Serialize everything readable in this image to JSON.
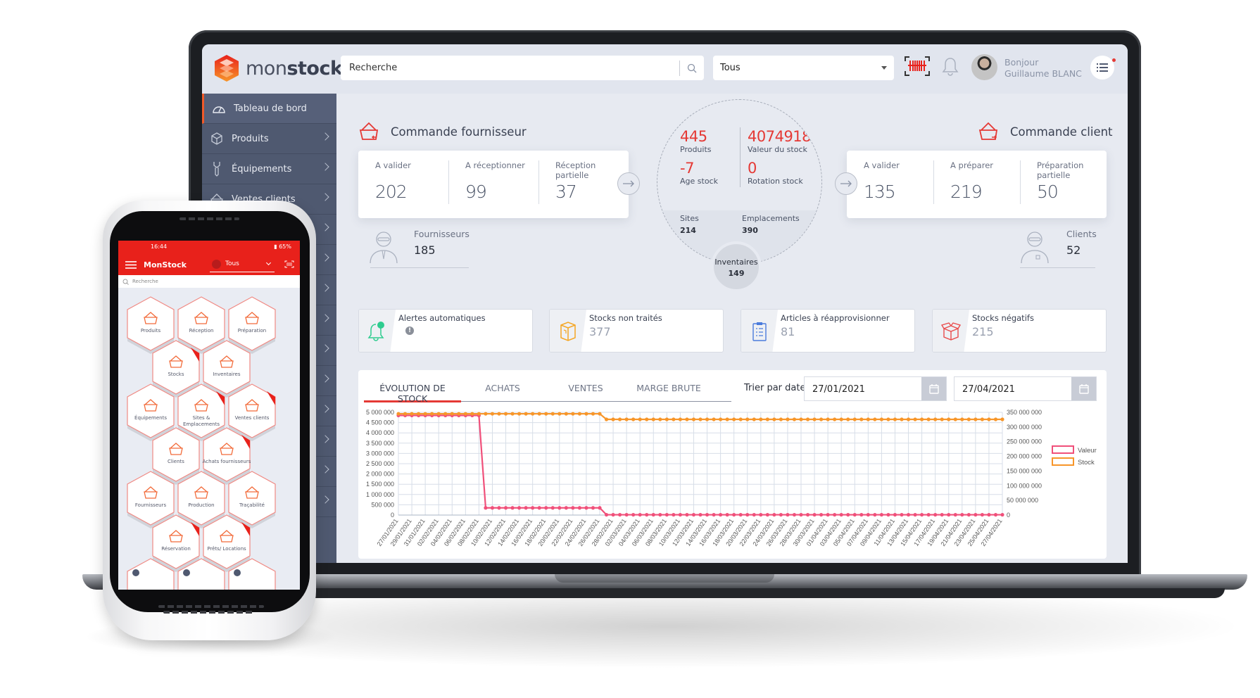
{
  "app": {
    "brand_light": "mon",
    "brand_bold": "stock",
    "accent_color": "#e53935",
    "sidebar_color": "#4f5970"
  },
  "header": {
    "search_placeholder": "Recherche",
    "filter_value": "Tous",
    "greeting": "Bonjour",
    "user_name": "Guillaume BLANC"
  },
  "sidebar": {
    "items": [
      {
        "label": "Tableau de bord",
        "icon": "dashboard-gauge-icon",
        "active": true
      },
      {
        "label": "Produits",
        "icon": "box-icon"
      },
      {
        "label": "Équipements",
        "icon": "wrench-icon"
      },
      {
        "label": "Ventes clients",
        "icon": "basket-icon"
      }
    ]
  },
  "supplier_orders": {
    "title": "Commande fournisseur",
    "stats": [
      {
        "label": "A valider",
        "value": "202"
      },
      {
        "label": "A réceptionner",
        "value": "99"
      },
      {
        "label": "Réception partielle",
        "value": "37"
      }
    ],
    "people_label": "Fournisseurs",
    "people_value": "185"
  },
  "client_orders": {
    "title": "Commande client",
    "stats": [
      {
        "label": "A valider",
        "value": "135"
      },
      {
        "label": "A préparer",
        "value": "219"
      },
      {
        "label": "Préparation partielle",
        "value": "50"
      }
    ],
    "people_label": "Clients",
    "people_value": "52"
  },
  "center_stats": {
    "products": {
      "value": "445",
      "label": "Produits"
    },
    "stock_value": {
      "value": "4074918",
      "label": "Valeur du stock"
    },
    "stock_age": {
      "value": "-7",
      "label": "Age stock"
    },
    "rotation": {
      "value": "0",
      "label": "Rotation stock"
    },
    "sites": {
      "label": "Sites",
      "value": "214"
    },
    "locations": {
      "label": "Emplacements",
      "value": "390"
    },
    "inventories": {
      "label": "Inventaires",
      "value": "149"
    }
  },
  "alerts": [
    {
      "title": "Alertes automatiques",
      "value": "!",
      "icon": "bell-alert-icon",
      "color": "#2ecc8f"
    },
    {
      "title": "Stocks non traités",
      "value": "377",
      "icon": "package-icon",
      "color": "#f5a623"
    },
    {
      "title": "Articles à réapprovisionner",
      "value": "81",
      "icon": "clipboard-list-icon",
      "color": "#4a7bdc"
    },
    {
      "title": "Stocks négatifs",
      "value": "215",
      "icon": "open-box-icon",
      "color": "#e94b4b"
    }
  ],
  "chart_panel": {
    "tabs": [
      "ÉVOLUTION DE STOCK",
      "ACHATS",
      "VENTES",
      "MARGE BRUTE"
    ],
    "active_tab": 0,
    "sort_label": "Trier par date",
    "date_from": "27/01/2021",
    "date_to": "27/04/2021"
  },
  "chart_data": {
    "type": "line",
    "title": "",
    "xlabel": "",
    "ylabel": "",
    "y_left": {
      "min": 0,
      "max": 5000000,
      "ticks": [
        "0",
        "500 000",
        "1 000 000",
        "1 500 000",
        "2 000 000",
        "2 500 000",
        "3 000 000",
        "3 500 000",
        "4 000 000",
        "4 500 000",
        "5 000 000"
      ]
    },
    "y_right": {
      "min": 0,
      "max": 350000000,
      "ticks": [
        "0",
        "50 000 000",
        "100 000 000",
        "150 000 000",
        "200 000 000",
        "250 000 000",
        "300 000 000",
        "350 000 000"
      ]
    },
    "x_start": "27/01/2021",
    "x_end": "27/04/2021",
    "x_tick_labels": [
      "27/01/2021",
      "29/01/2021",
      "31/01/2021",
      "02/02/2021",
      "04/02/2021",
      "06/02/2021",
      "08/02/2021",
      "10/02/2021",
      "12/02/2021",
      "14/02/2021",
      "16/02/2021",
      "18/02/2021",
      "20/02/2021",
      "22/02/2021",
      "24/02/2021",
      "26/02/2021",
      "28/02/2021",
      "02/03/2021",
      "04/03/2021",
      "06/03/2021",
      "08/03/2021",
      "10/03/2021",
      "12/03/2021",
      "14/03/2021",
      "16/03/2021",
      "18/03/2021",
      "20/03/2021",
      "22/03/2021",
      "24/03/2021",
      "26/03/2021",
      "28/03/2021",
      "30/03/2021",
      "01/04/2021",
      "03/04/2021",
      "05/04/2021",
      "07/04/2021",
      "09/04/2021",
      "11/04/2021",
      "13/04/2021",
      "15/04/2021",
      "17/04/2021",
      "19/04/2021",
      "21/04/2021",
      "23/04/2021",
      "25/04/2021",
      "27/04/2021"
    ],
    "grid": true,
    "legend_position": "right",
    "series": [
      {
        "name": "Valeur",
        "axis": "left",
        "color": "#f0507a",
        "segments": [
          {
            "from_index": 0,
            "to_index": 12,
            "value": 4850000
          },
          {
            "from_index": 13,
            "to_index": 30,
            "value": 350000
          },
          {
            "from_index": 31,
            "to_index": 91,
            "value": 15000
          }
        ]
      },
      {
        "name": "Stock",
        "axis": "right",
        "color": "#f7962a",
        "segments": [
          {
            "from_index": 0,
            "to_index": 30,
            "value": 345000000
          },
          {
            "from_index": 31,
            "to_index": 91,
            "value": 326000000
          }
        ]
      }
    ]
  },
  "phone": {
    "time": "16:44",
    "battery": "65%",
    "app_title": "MonStock",
    "filter_value": "Tous",
    "search_placeholder": "Recherche",
    "tiles": [
      {
        "label": "Produits"
      },
      {
        "label": "Réception"
      },
      {
        "label": "Préparation"
      },
      {
        "label": "Stocks",
        "badge": true
      },
      {
        "label": "Inventaires"
      },
      {
        "label": "Équipements"
      },
      {
        "label": "Sites & Emplacements",
        "badge": true
      },
      {
        "label": "Ventes clients",
        "badge": true
      },
      {
        "label": "Clients"
      },
      {
        "label": "Achats fournisseurs",
        "badge": true
      },
      {
        "label": "Fournisseurs"
      },
      {
        "label": "Production"
      },
      {
        "label": "Traçabilité"
      },
      {
        "label": "Réservation",
        "badge": true
      },
      {
        "label": "Prêts/ Locations",
        "badge": true
      }
    ]
  }
}
